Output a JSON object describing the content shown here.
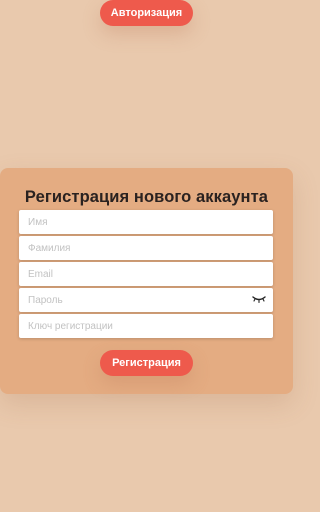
{
  "header": {
    "auth_button_label": "Авторизация"
  },
  "registration": {
    "title": "Регистрация нового аккаунта",
    "fields": {
      "first_name": {
        "value": "",
        "placeholder": "Имя"
      },
      "last_name": {
        "value": "",
        "placeholder": "Фамилия"
      },
      "email": {
        "value": "",
        "placeholder": "Email"
      },
      "password": {
        "value": "",
        "placeholder": "Пароль",
        "toggle_icon": "eye-closed-icon"
      },
      "registration_key": {
        "value": "",
        "placeholder": "Ключ регистрации"
      }
    },
    "submit_label": "Регистрация"
  },
  "colors": {
    "background": "#e9c9ad",
    "card": "#e4ac82",
    "accent_button": "#ee5a4c",
    "title_text": "#2a2220",
    "placeholder_text": "#c2c2c2"
  }
}
